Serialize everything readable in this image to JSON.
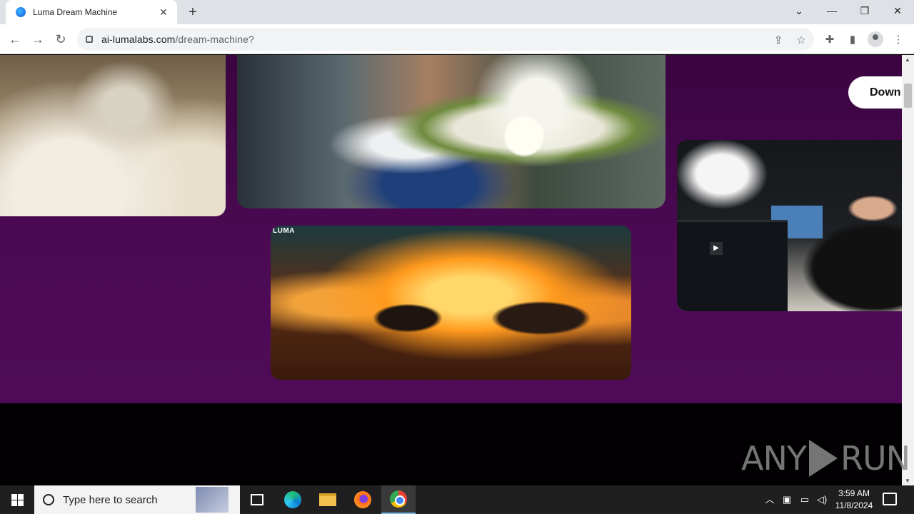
{
  "browser": {
    "tab_title": "Luma Dream Machine",
    "tab_close": "✕",
    "new_tab": "+",
    "url_host": "ai-lumalabs.com",
    "url_path": "/dream-machine?",
    "controls": {
      "dropdown": "⌄",
      "minimize": "—",
      "restore": "❐",
      "close": "✕"
    }
  },
  "page": {
    "download_label": "Down",
    "luma_badge": "LUMA",
    "play_glyph": "▶",
    "colors": {
      "background_purple": "#4d0a55",
      "footer_black": "#020002"
    }
  },
  "watermark": {
    "left": "ANY",
    "right": "RUN"
  },
  "taskbar": {
    "search_placeholder": "Type here to search",
    "time": "3:59 AM",
    "date": "11/8/2024"
  }
}
